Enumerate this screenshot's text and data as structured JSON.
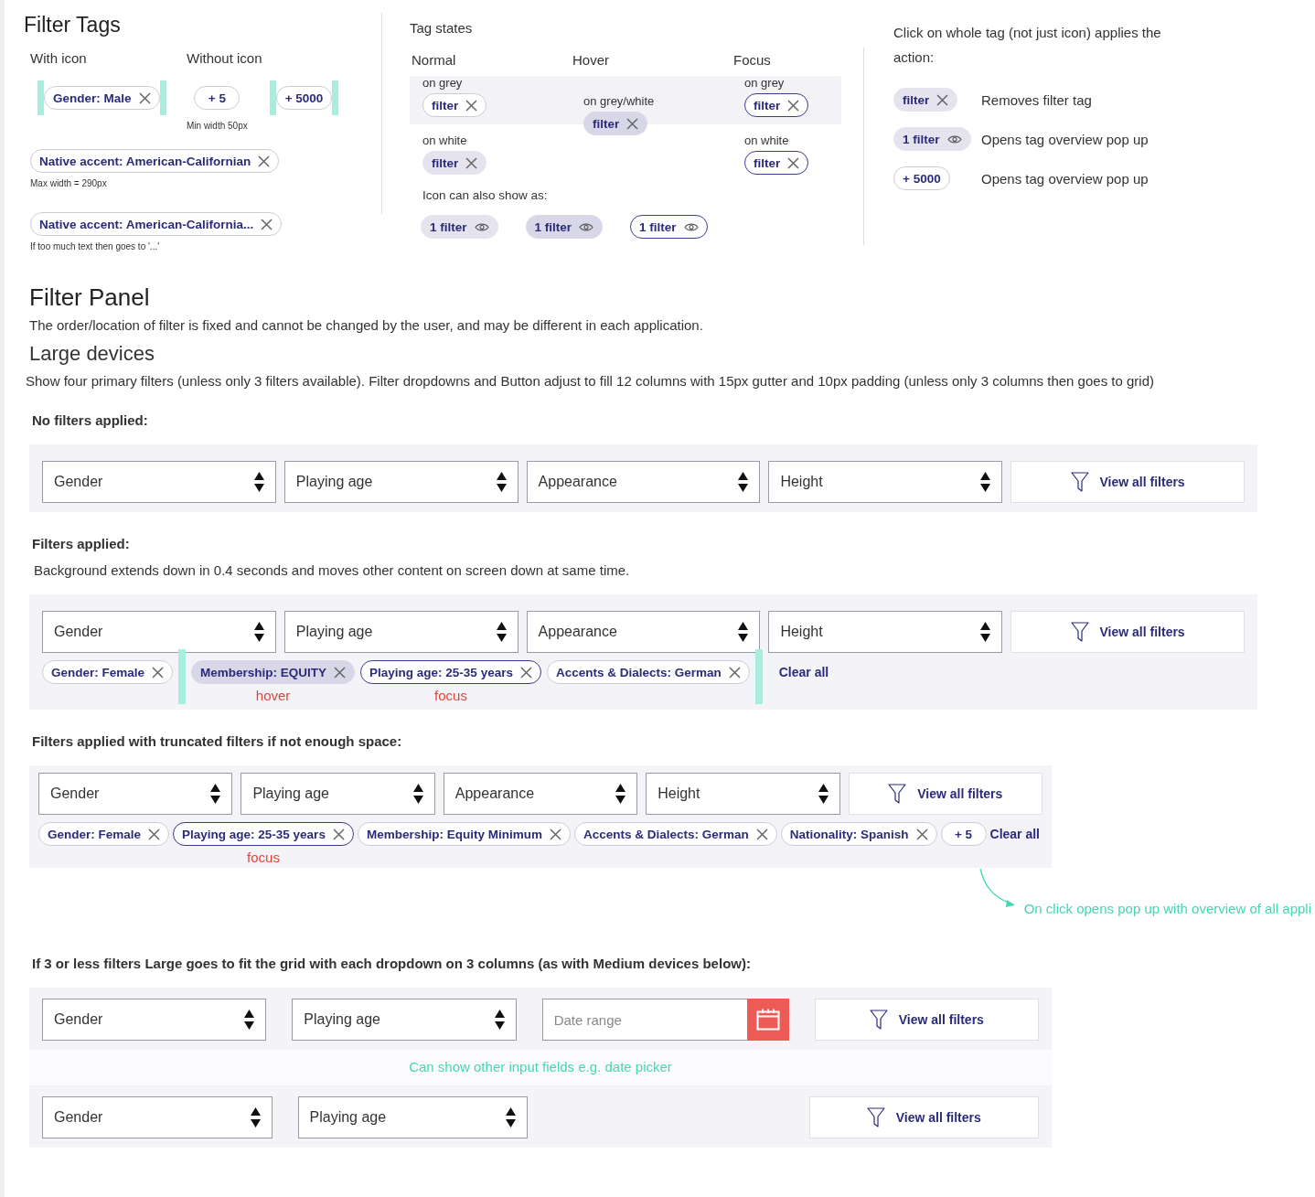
{
  "filter_tags": {
    "title": "Filter Tags",
    "with_icon": {
      "heading": "With icon",
      "tag": {
        "kind": "remove",
        "label": "Gender: Male",
        "hover": false,
        "focus": false,
        "filled": false,
        "guides": true
      }
    },
    "without_icon": {
      "heading": "Without icon",
      "tags": [
        {
          "kind": "count",
          "label": "+ 5",
          "hover": false,
          "focus": false,
          "filled": false,
          "guides": false,
          "note": "Min width 50px"
        },
        {
          "kind": "count",
          "label": "+ 5000",
          "hover": false,
          "focus": false,
          "filled": false,
          "guides": true
        }
      ]
    },
    "examples": [
      {
        "tag": {
          "kind": "remove",
          "label": "Native accent: American-Californian",
          "hover": false,
          "focus": false,
          "filled": false
        },
        "note": "Max width = 290px"
      },
      {
        "tag": {
          "kind": "remove",
          "label": "Native accent: American-California...",
          "hover": false,
          "focus": false,
          "filled": false
        },
        "note": "If too much text then goes to '...'"
      }
    ]
  },
  "tag_states": {
    "title": "Tag states",
    "columns": [
      {
        "heading": "Normal",
        "cells": [
          {
            "caption": "on grey",
            "grey_ground": true,
            "tag": {
              "kind": "remove",
              "label": "filter",
              "hover": false,
              "focus": false,
              "filled": false
            }
          },
          {
            "caption": "on white",
            "grey_ground": false,
            "tag": {
              "kind": "remove",
              "label": "filter",
              "hover": false,
              "focus": false,
              "filled": true
            }
          }
        ]
      },
      {
        "heading": "Hover",
        "cells": [
          {
            "caption": "on grey/white",
            "grey_ground": true,
            "tag": {
              "kind": "remove",
              "label": "filter",
              "hover": true,
              "focus": false
            }
          }
        ]
      },
      {
        "heading": "Focus",
        "cells": [
          {
            "caption": "on grey",
            "grey_ground": true,
            "tag": {
              "kind": "remove",
              "label": "filter",
              "hover": false,
              "focus": true,
              "filled": false
            }
          },
          {
            "caption": "on white",
            "grey_ground": false,
            "tag": {
              "kind": "remove",
              "label": "filter",
              "hover": false,
              "focus": true,
              "filled": false
            }
          }
        ]
      }
    ],
    "icon_alternatives": {
      "caption": "Icon can also show as:",
      "tags": [
        {
          "kind": "overview",
          "label": "1 filter",
          "hover": false,
          "focus": false,
          "filled": true
        },
        {
          "kind": "overview",
          "label": "1 filter",
          "hover": true,
          "focus": false
        },
        {
          "kind": "overview",
          "label": "1 filter",
          "hover": false,
          "focus": true,
          "filled": false
        }
      ]
    }
  },
  "actions": {
    "title": "Click on whole tag (not just icon) applies the action:",
    "items": [
      {
        "tag": {
          "kind": "remove",
          "label": "filter",
          "hover": false,
          "focus": false,
          "filled": true
        },
        "description": "Removes filter tag"
      },
      {
        "tag": {
          "kind": "overview",
          "label": "1 filter",
          "hover": false,
          "focus": false,
          "filled": true
        },
        "description": "Opens tag overview pop up"
      },
      {
        "tag": {
          "kind": "count",
          "label": "+ 5000",
          "hover": false,
          "focus": false,
          "filled": false
        },
        "description": "Opens tag overview pop up"
      }
    ]
  },
  "filter_panel": {
    "title": "Filter Panel",
    "description": "The order/location of filter is fixed and cannot be changed by the user, and may be different in each application.",
    "large_devices": {
      "title": "Large devices",
      "description": "Show four primary filters (unless only 3 filters available). Filter dropdowns and Button adjust to fill 12 columns with 15px gutter and 10px padding (unless only 3 columns then goes to grid)"
    },
    "sections": [
      {
        "kind": "wide",
        "heading": "No filters applied:",
        "panels": [
          {
            "fields": [
              {
                "kind": "dropdown",
                "label": "Gender"
              },
              {
                "kind": "dropdown",
                "label": "Playing age"
              },
              {
                "kind": "dropdown",
                "label": "Appearance"
              },
              {
                "kind": "dropdown",
                "label": "Height"
              },
              {
                "kind": "button",
                "label": "View all filters"
              }
            ]
          }
        ]
      },
      {
        "kind": "wide",
        "heading": "Filters applied:",
        "description": "Background extends down in 0.4 seconds and moves other content on screen down at same time.",
        "panels": [
          {
            "fields": [
              {
                "kind": "dropdown",
                "label": "Gender"
              },
              {
                "kind": "dropdown",
                "label": "Playing age"
              },
              {
                "kind": "dropdown",
                "label": "Appearance"
              },
              {
                "kind": "dropdown",
                "label": "Height"
              },
              {
                "kind": "button",
                "label": "View all filters"
              }
            ],
            "tags": [
              {
                "kind": "remove",
                "label": "Gender: Female",
                "hover": false,
                "focus": false,
                "filled": false
              },
              {
                "kind": "guide"
              },
              {
                "kind": "remove",
                "label": "Membership: EQUITY",
                "hover": true,
                "focus": false,
                "note": "hover"
              },
              {
                "kind": "remove",
                "label": "Playing age: 25-35 years",
                "hover": false,
                "focus": true,
                "filled": false,
                "note": "focus"
              },
              {
                "kind": "remove",
                "label": "Accents & Dialects: German",
                "hover": false,
                "focus": false,
                "filled": false
              },
              {
                "kind": "guide"
              },
              {
                "kind": "clear",
                "label": "Clear all"
              }
            ]
          }
        ]
      },
      {
        "kind": "truncated",
        "heading": "Filters applied with truncated filters if not enough space:",
        "panels": [
          {
            "fields": [
              {
                "kind": "dropdown",
                "label": "Gender"
              },
              {
                "kind": "dropdown",
                "label": "Playing age"
              },
              {
                "kind": "dropdown",
                "label": "Appearance"
              },
              {
                "kind": "dropdown",
                "label": "Height"
              },
              {
                "kind": "button",
                "label": "View all filters"
              }
            ],
            "tags": [
              {
                "kind": "remove",
                "label": "Gender: Female",
                "hover": false,
                "focus": false,
                "filled": false
              },
              {
                "kind": "remove",
                "label": "Playing age: 25-35 years",
                "hover": false,
                "focus": true,
                "filled": false,
                "note": "focus"
              },
              {
                "kind": "remove",
                "label": "Membership: Equity Minimum",
                "hover": false,
                "focus": false,
                "filled": false
              },
              {
                "kind": "remove",
                "label": "Accents & Dialects: German",
                "hover": false,
                "focus": false,
                "filled": false
              },
              {
                "kind": "remove",
                "label": "Nationality: Spanish",
                "hover": false,
                "focus": false,
                "filled": false
              },
              {
                "kind": "count",
                "label": "+ 5",
                "hover": false,
                "focus": false,
                "filled": false
              },
              {
                "kind": "clear",
                "label": "Clear all"
              }
            ],
            "annotation": "On click opens pop up with overview of all appli"
          }
        ]
      },
      {
        "kind": "grid",
        "heading": "If 3 or less filters Large goes to fit the grid with each dropdown on 3 columns (as with Medium devices below):",
        "panels": [
          {
            "fields": [
              {
                "kind": "dropdown",
                "label": "Gender"
              },
              {
                "kind": "dropdown",
                "label": "Playing age"
              },
              {
                "kind": "date",
                "placeholder": "Date range"
              },
              {
                "kind": "button",
                "label": "View all filters"
              }
            ],
            "caption": "Can show other input fields e.g. date picker"
          },
          {
            "fields": [
              {
                "kind": "dropdown",
                "label": "Gender"
              },
              {
                "kind": "dropdown",
                "label": "Playing age"
              },
              {
                "kind": "empty"
              },
              {
                "kind": "button",
                "label": "View all filters"
              }
            ]
          }
        ]
      }
    ]
  }
}
